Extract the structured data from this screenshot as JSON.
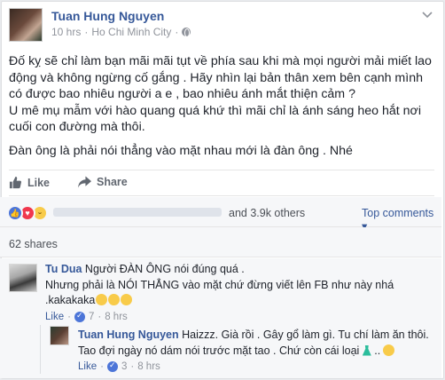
{
  "post": {
    "author": "Tuan Hung Nguyen",
    "time": "10 hrs",
    "separator": "·",
    "location": "Ho Chi Minh City",
    "dot2": "·",
    "paragraph1": "Đố kỵ sẽ chỉ làm bạn mãi mãi tụt về phía sau khi mà mọi người mải miết lao động và không ngừng cố gắng . Hãy nhìn lại bản thân xem bên cạnh mình có được bao nhiêu người a e , bao nhiêu ánh mắt thiện cảm ?",
    "paragraph2": "U mê mụ mẫm với hào quang quá khứ thì mãi chỉ là ánh sáng heo hắt nơi cuối con đường mà thôi.",
    "paragraph3": "Đàn ông là phải nói thẳng vào mặt nhau mới là đàn ông . Nhé"
  },
  "actions": {
    "like_label": "Like",
    "share_label": "Share"
  },
  "reactions": {
    "count_text": "and 3.9k others",
    "top_comments_label": "Top comments ▾",
    "shares_text": "62 shares"
  },
  "comments": [
    {
      "name": "Tu Dua",
      "text_line1": "Người ĐÀN ÔNG nói đúng quá .",
      "text_line2": "Nhưng phải là NÓI THẲNG vào mặt chứ đừng viết lên FB như này nhá",
      "text_line3": ".kakakaka",
      "like_label": "Like",
      "likes": "7",
      "time": "8 hrs"
    },
    {
      "name": "Tuan Hung Nguyen",
      "text_line1": "Haizzz. Già rồi . Gây gổ làm gì. Tu chí làm ăn thôi.",
      "text_line2": "Tao đợi ngày nó dám nói trước mặt tao . Chứ còn cái loại",
      "like_label": "Like",
      "likes": "3",
      "time": "8 hrs"
    }
  ],
  "colors": {
    "link_blue": "#365899",
    "like_blue": "#4c75d8",
    "love_red": "#f0374d",
    "haha_yellow": "#f8cb4a",
    "meta_gray": "#90949c"
  },
  "icons": [
    "globe-icon",
    "chevron-down-icon",
    "like-icon",
    "share-icon",
    "like-reaction-icon",
    "love-reaction-icon",
    "haha-reaction-icon",
    "haha-emoji-icon",
    "dress-icon",
    "wink-emoji-icon"
  ]
}
